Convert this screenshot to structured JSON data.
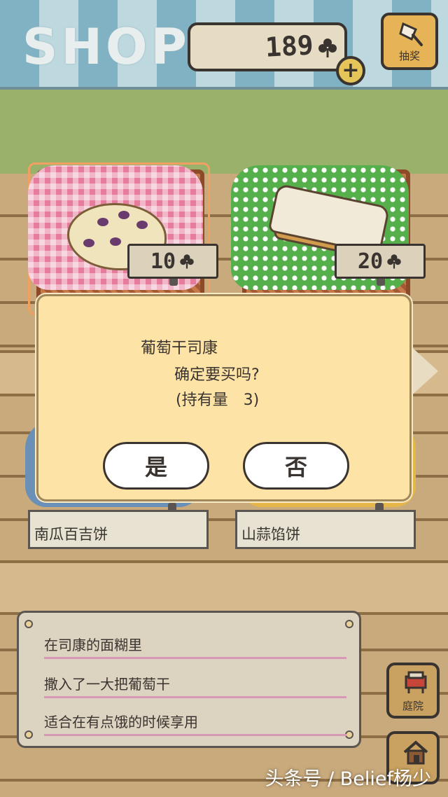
{
  "header": {
    "title": "SHOP",
    "currency_amount": "189",
    "currency_icon": "clover-icon",
    "add_label": "+",
    "lottery_label": "抽奖"
  },
  "items": [
    {
      "price": "10",
      "name": "南瓜百吉饼",
      "selected": true,
      "food_icon": "raisin-scone-icon"
    },
    {
      "price": "20",
      "name": "山蒜馅饼",
      "selected": false,
      "food_icon": "sandwich-icon"
    }
  ],
  "dialog": {
    "item_name": "葡萄干司康",
    "question": "确定要买吗?",
    "owned_text": "(持有量　3)",
    "yes_label": "是",
    "no_label": "否"
  },
  "description": {
    "lines": [
      "在司康的面糊里",
      "撒入了一大把葡萄干",
      "适合在有点饿的时候享用"
    ]
  },
  "side_buttons": {
    "yard_label": "庭院",
    "home_icon": "house-icon"
  },
  "watermark": "头条号 / Belief杨少",
  "colors": {
    "dialog_bg": "#fde3a6",
    "awning_dark": "#80b2c4",
    "awning_light": "#bdd8de",
    "grass": "#99b16b"
  }
}
